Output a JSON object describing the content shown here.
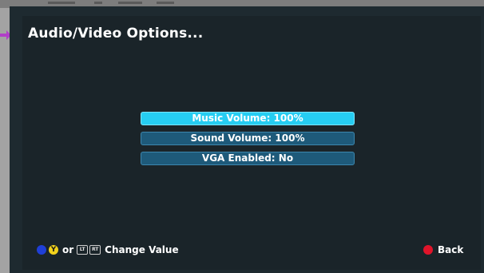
{
  "screen": {
    "title": "Audio/Video Options..."
  },
  "menu": {
    "items": [
      {
        "label": "Music Volume: 100%",
        "selected": true
      },
      {
        "label": "Sound Volume: 100%",
        "selected": false
      },
      {
        "label": "VGA Enabled: No",
        "selected": false
      }
    ]
  },
  "footer": {
    "left": {
      "icons": [
        "x-button-icon",
        "y-button-icon",
        "lt-trigger-icon",
        "rt-trigger-icon"
      ],
      "y_glyph": "Y",
      "or_text": "or",
      "lt_glyph": "LT",
      "rt_glyph": "RT",
      "action": "Change Value"
    },
    "right": {
      "icon": "b-button-icon",
      "action": "Back"
    }
  },
  "colors": {
    "selected_item": "#26cdf2",
    "item": "#1e5a7a",
    "screen_bg": "#1a2429",
    "x_button": "#1f3fd6",
    "y_button": "#f2d21c",
    "b_button": "#e0142a",
    "pointer_arrow": "#b13fc8"
  }
}
